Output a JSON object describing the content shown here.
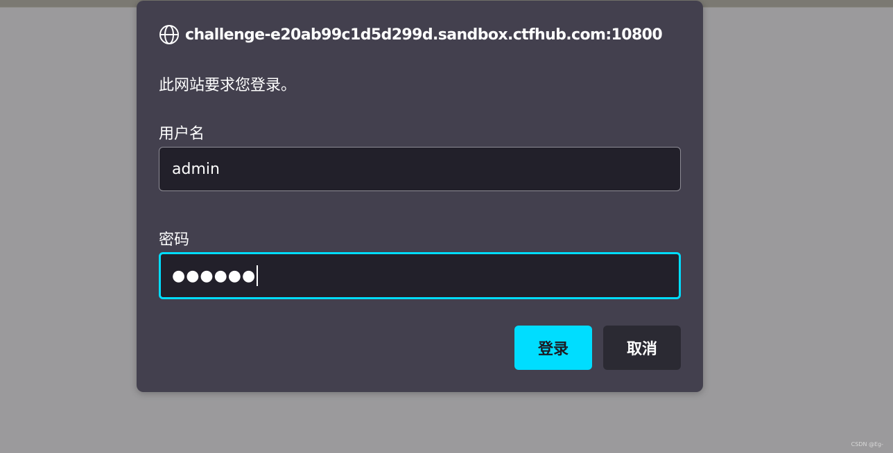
{
  "dialog": {
    "origin": "challenge-e20ab99c1d5d299d.sandbox.ctfhub.com:10800",
    "message": "此网站要求您登录。",
    "username_label": "用户名",
    "username_value": "admin",
    "password_label": "密码",
    "password_masked": "●●●●●●",
    "login_button": "登录",
    "cancel_button": "取消"
  },
  "watermark": "CSDN @Eg-",
  "icons": {
    "origin": "globe-icon"
  },
  "colors": {
    "dialog_bg": "#43404e",
    "input_bg": "#22202a",
    "accent": "#00ddff",
    "backdrop": "#9b9a9c"
  }
}
